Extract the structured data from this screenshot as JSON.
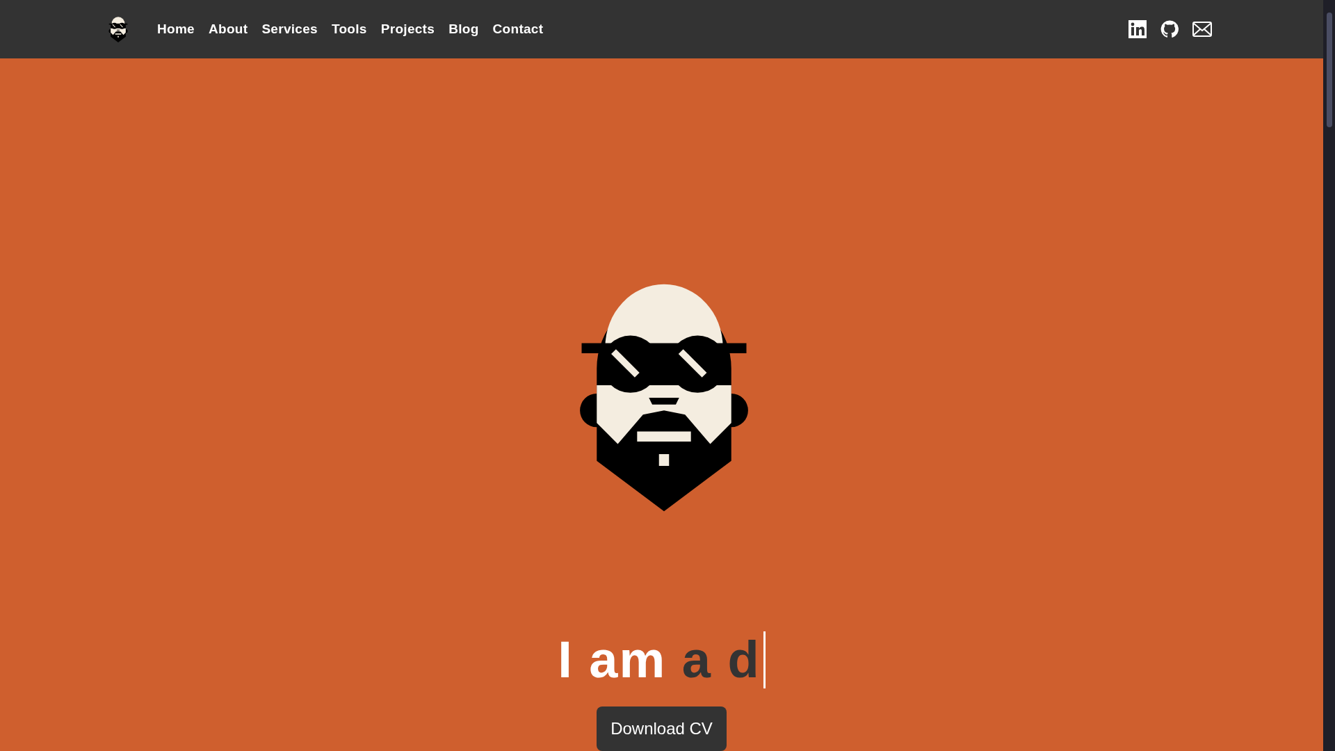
{
  "nav": {
    "links": [
      {
        "label": "Home"
      },
      {
        "label": "About"
      },
      {
        "label": "Services"
      },
      {
        "label": "Tools"
      },
      {
        "label": "Projects"
      },
      {
        "label": "Blog"
      },
      {
        "label": "Contact"
      }
    ]
  },
  "hero": {
    "headline_lead": "I am",
    "headline_typed": "a d",
    "button": "Download CV"
  }
}
